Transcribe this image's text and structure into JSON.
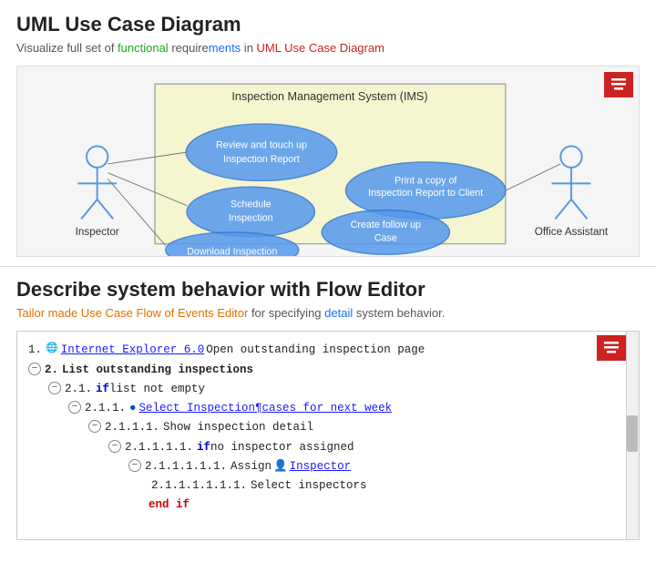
{
  "section1": {
    "title": "UML Use Case Diagram",
    "subtitle_parts": [
      {
        "text": "Visualize full set of ",
        "style": "normal"
      },
      {
        "text": "functional",
        "style": "green"
      },
      {
        "text": " require",
        "style": "normal"
      },
      {
        "text": "ments",
        "style": "blue"
      },
      {
        "text": " in ",
        "style": "normal"
      },
      {
        "text": "UML Use Case Diagram",
        "style": "red"
      }
    ],
    "diagram": {
      "system_label": "Inspection Management System (IMS)",
      "actors": [
        "Inspector",
        "Office Assistant"
      ],
      "use_cases": [
        "Review and touch up Inspection Report",
        "Print a copy of Inspection Report to Client",
        "Schedule Inspection",
        "Create follow up Case",
        "Download Inspection"
      ]
    }
  },
  "section2": {
    "title": "Describe system behavior with Flow Editor",
    "subtitle": "Tailor made Use Case Flow of Events Editor for specifying detail system behavior.",
    "subtitle_parts": [
      {
        "text": "Tailor made ",
        "style": "normal"
      },
      {
        "text": "Use Case Flow of Events Editor",
        "style": "orange"
      },
      {
        "text": " for specifying ",
        "style": "normal"
      },
      {
        "text": "detail",
        "style": "blue"
      },
      {
        "text": " system behavior.",
        "style": "normal"
      }
    ],
    "flow_lines": [
      {
        "indent": 0,
        "num": "1.",
        "icon": "ie",
        "text": "Internet Explorer 6.0",
        "text2": " Open outstanding inspection page",
        "has_minus": false
      },
      {
        "indent": 0,
        "num": "2.",
        "text": " List outstanding inspections",
        "has_minus": true,
        "style": "bold"
      },
      {
        "indent": 1,
        "num": "2.1.",
        "keyword_if": "if",
        "text": " list not empty",
        "has_minus": true
      },
      {
        "indent": 2,
        "num": "2.1.1.",
        "text": "●",
        "link": "Select Inspection¶cases for next week",
        "has_minus": true
      },
      {
        "indent": 3,
        "num": "2.1.1.1.",
        "text": " Show inspection detail",
        "has_minus": true
      },
      {
        "indent": 4,
        "num": "2.1.1.1.1.",
        "keyword_if": "if",
        "text": "  no inspector assigned",
        "has_minus": true
      },
      {
        "indent": 5,
        "num": "2.1.1.1.1.1.",
        "text": " Assign ",
        "person_icon": true,
        "link2": "Inspector",
        "has_minus": true
      },
      {
        "indent": 6,
        "num": "2.1.1.1.1.1.1.",
        "text": " Select inspectors",
        "has_minus": false
      },
      {
        "indent": 5,
        "num": "",
        "keyword_end": "end if",
        "has_minus": false
      }
    ]
  },
  "icons": {
    "toolbar": "≡"
  }
}
